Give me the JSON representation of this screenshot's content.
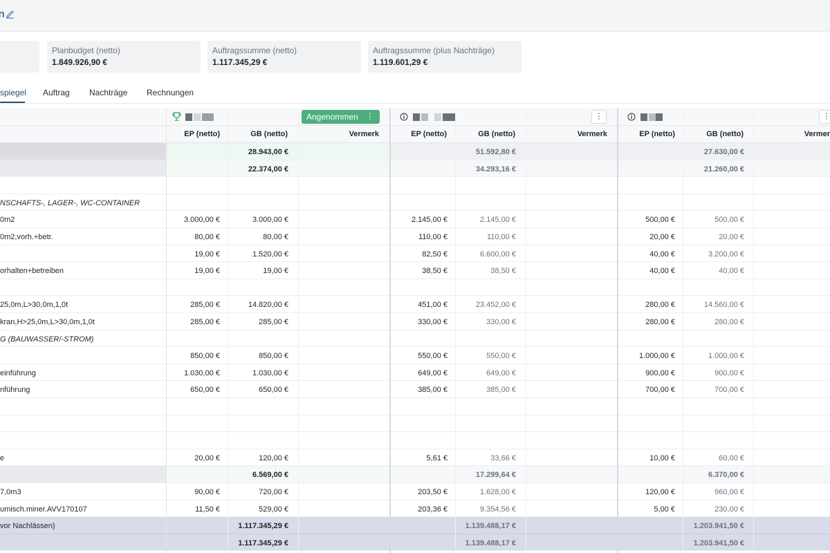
{
  "header": {
    "title": "n"
  },
  "cards": [
    {
      "label": "",
      "value": ""
    },
    {
      "label": "Planbudget (netto)",
      "value": "1.849.926,90 €"
    },
    {
      "label": "Auftragssumme (netto)",
      "value": "1.117.345,29 €"
    },
    {
      "label": "Auftragssumme (plus Nachträge)",
      "value": "1.119.601,29 €"
    }
  ],
  "tabs": [
    {
      "label": "spiegel"
    },
    {
      "label": "Auftrag"
    },
    {
      "label": "Nachträge"
    },
    {
      "label": "Rechnungen"
    }
  ],
  "bidders": {
    "status_label": "Angenommen",
    "menu_glyph": "⋮"
  },
  "columns": {
    "ep": "EP (netto)",
    "gb": "GB (netto)",
    "vermerk": "Vermerk",
    "vermerk_cut": "Vermer"
  },
  "colors": {
    "accent": "#27506b",
    "accepted": "#4caf7d",
    "highlight_green": "#eef7f1",
    "summary_purple": "#d9dbea",
    "group_grey": "#dcdde2"
  },
  "rows": [
    {
      "type": "group1",
      "desc": "",
      "b1_ep": "",
      "b1_gb": "28.943,00 €",
      "b2_ep": "",
      "b2_gb": "51.592,80 €",
      "b3_ep": "",
      "b3_gb": "27.630,00 €"
    },
    {
      "type": "group2",
      "desc": "",
      "b1_ep": "",
      "b1_gb": "22.374,00 €",
      "b2_ep": "",
      "b2_gb": "34.293,16 €",
      "b3_ep": "",
      "b3_gb": "21.260,00 €"
    },
    {
      "type": "plain",
      "desc": "",
      "b1_ep": "",
      "b1_gb": "",
      "b2_ep": "",
      "b2_gb": "",
      "b3_ep": "",
      "b3_gb": ""
    },
    {
      "type": "title",
      "desc": "NSCHAFTS-, LAGER-, WC-CONTAINER",
      "b1_ep": "",
      "b1_gb": "",
      "b2_ep": "",
      "b2_gb": "",
      "b3_ep": "",
      "b3_gb": ""
    },
    {
      "type": "plain",
      "desc": "0m2",
      "b1_ep": "3.000,00 €",
      "b1_gb": "3.000,00 €",
      "b2_ep": "2.145,00 €",
      "b2_gb": "2.145,00 €",
      "b3_ep": "500,00 €",
      "b3_gb": "500,00 €"
    },
    {
      "type": "plain",
      "desc": "0m2,vorh.+betr.",
      "b1_ep": "80,00 €",
      "b1_gb": "80,00 €",
      "b2_ep": "110,00 €",
      "b2_gb": "110,00 €",
      "b3_ep": "20,00 €",
      "b3_gb": "20,00 €"
    },
    {
      "type": "plain",
      "desc": "",
      "b1_ep": "19,00 €",
      "b1_gb": "1.520,00 €",
      "b2_ep": "82,50 €",
      "b2_gb": "6.600,00 €",
      "b3_ep": "40,00 €",
      "b3_gb": "3.200,00 €"
    },
    {
      "type": "plain",
      "desc": "orhalten+betreiben",
      "b1_ep": "19,00 €",
      "b1_gb": "19,00 €",
      "b2_ep": "38,50 €",
      "b2_gb": "38,50 €",
      "b3_ep": "40,00 €",
      "b3_gb": "40,00 €"
    },
    {
      "type": "plain",
      "desc": "",
      "b1_ep": "",
      "b1_gb": "",
      "b2_ep": "",
      "b2_gb": "",
      "b3_ep": "",
      "b3_gb": ""
    },
    {
      "type": "plain",
      "desc": "25,0m,L>30,0m,1,0t",
      "b1_ep": "285,00 €",
      "b1_gb": "14.820,00 €",
      "b2_ep": "451,00 €",
      "b2_gb": "23.452,00 €",
      "b3_ep": "280,00 €",
      "b3_gb": "14.560,00 €"
    },
    {
      "type": "plain",
      "desc": "kran,H>25,0m,L>30,0m,1,0t",
      "b1_ep": "285,00 €",
      "b1_gb": "285,00 €",
      "b2_ep": "330,00 €",
      "b2_gb": "330,00 €",
      "b3_ep": "280,00 €",
      "b3_gb": "280,00 €"
    },
    {
      "type": "title",
      "desc": "G (BAUWASSER/-STROM)",
      "b1_ep": "",
      "b1_gb": "",
      "b2_ep": "",
      "b2_gb": "",
      "b3_ep": "",
      "b3_gb": ""
    },
    {
      "type": "plain",
      "desc": "",
      "b1_ep": "850,00 €",
      "b1_gb": "850,00 €",
      "b2_ep": "550,00 €",
      "b2_gb": "550,00 €",
      "b3_ep": "1.000,00 €",
      "b3_gb": "1.000,00 €"
    },
    {
      "type": "plain",
      "desc": "einführung",
      "b1_ep": "1.030,00 €",
      "b1_gb": "1.030,00 €",
      "b2_ep": "649,00 €",
      "b2_gb": "649,00 €",
      "b3_ep": "900,00 €",
      "b3_gb": "900,00 €"
    },
    {
      "type": "plain",
      "desc": "nführung",
      "b1_ep": "650,00 €",
      "b1_gb": "650,00 €",
      "b2_ep": "385,00 €",
      "b2_gb": "385,00 €",
      "b3_ep": "700,00 €",
      "b3_gb": "700,00 €"
    },
    {
      "type": "plain",
      "desc": "",
      "b1_ep": "",
      "b1_gb": "",
      "b2_ep": "",
      "b2_gb": "",
      "b3_ep": "",
      "b3_gb": ""
    },
    {
      "type": "plain",
      "desc": "",
      "b1_ep": "",
      "b1_gb": "",
      "b2_ep": "",
      "b2_gb": "",
      "b3_ep": "",
      "b3_gb": ""
    },
    {
      "type": "plain",
      "desc": "",
      "b1_ep": "",
      "b1_gb": "",
      "b2_ep": "",
      "b2_gb": "",
      "b3_ep": "",
      "b3_gb": ""
    },
    {
      "type": "plain",
      "desc": "e",
      "b1_ep": "20,00 €",
      "b1_gb": "120,00 €",
      "b2_ep": "5,61 €",
      "b2_gb": "33,66 €",
      "b3_ep": "10,00 €",
      "b3_gb": "60,00 €"
    },
    {
      "type": "group2",
      "desc": "",
      "b1_ep": "",
      "b1_gb": "6.569,00 €",
      "b2_ep": "",
      "b2_gb": "17.299,64 €",
      "b3_ep": "",
      "b3_gb": "6.370,00 €"
    },
    {
      "type": "plain",
      "desc": "7,0m3",
      "b1_ep": "90,00 €",
      "b1_gb": "720,00 €",
      "b2_ep": "203,50 €",
      "b2_gb": "1.628,00 €",
      "b3_ep": "120,00 €",
      "b3_gb": "960,00 €"
    },
    {
      "type": "plain",
      "desc": "umisch.miner.AVV170107",
      "b1_ep": "11,50 €",
      "b1_gb": "529,00 €",
      "b2_ep": "203,36 €",
      "b2_gb": "9.354,56 €",
      "b3_ep": "5,00 €",
      "b3_gb": "230,00 €"
    },
    {
      "type": "sum1",
      "desc": "vor Nachlässen)",
      "b1_ep": "",
      "b1_gb": "1.117.345,29 €",
      "b2_ep": "",
      "b2_gb": "1.139.488,17 €",
      "b3_ep": "",
      "b3_gb": "1.203.941,50 €"
    },
    {
      "type": "sum2",
      "desc": "",
      "b1_ep": "",
      "b1_gb": "1.117.345,29 €",
      "b2_ep": "",
      "b2_gb": "1.139.488,17 €",
      "b3_ep": "",
      "b3_gb": "1.203.941,50 €"
    }
  ]
}
